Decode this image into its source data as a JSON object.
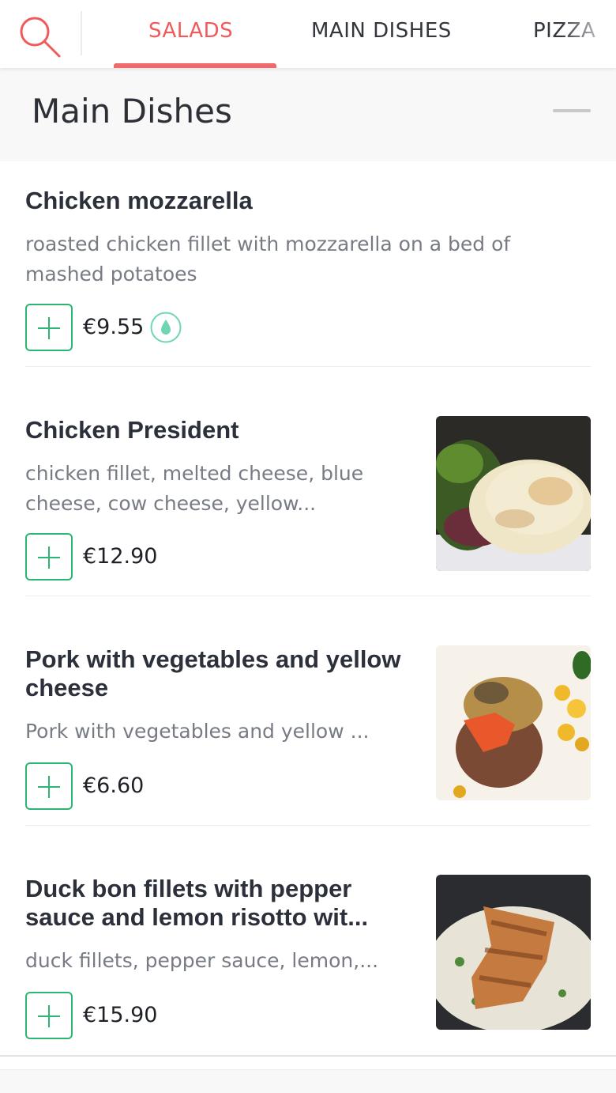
{
  "nav": {
    "tabs": [
      {
        "label": "SALADS",
        "active": true
      },
      {
        "label": "MAIN DISHES",
        "active": false
      },
      {
        "label": "PIZZA",
        "active": false
      }
    ],
    "search_icon": "search-icon",
    "accent_color": "#ef5b5b"
  },
  "section": {
    "title": "Main Dishes"
  },
  "dishes": [
    {
      "name": "Chicken mozzarella",
      "description": "roasted chicken fillet with mozzarella on a bed of mashed potatoes",
      "price": "€9.55",
      "badge_icon": "droplet-icon"
    },
    {
      "name": "Chicken President",
      "description": "chicken fillet, melted cheese, blue cheese, cow cheese, yellow...",
      "price": "€12.90",
      "image": "chicken-president-photo"
    },
    {
      "name": "Pork with vegetables and yellow cheese",
      "description": "Pork with vegetables and yellow ...",
      "price": "€6.60",
      "image": "pork-vegetables-photo"
    },
    {
      "name": "Duck bon fillets with pepper sauce and lemon risotto wit...",
      "description": "duck fillets, pepper sauce, lemon,...",
      "price": "€15.90",
      "image": "duck-risotto-photo"
    }
  ],
  "colors": {
    "add_button": "#2bb673",
    "badge": "#6fd6b0"
  }
}
